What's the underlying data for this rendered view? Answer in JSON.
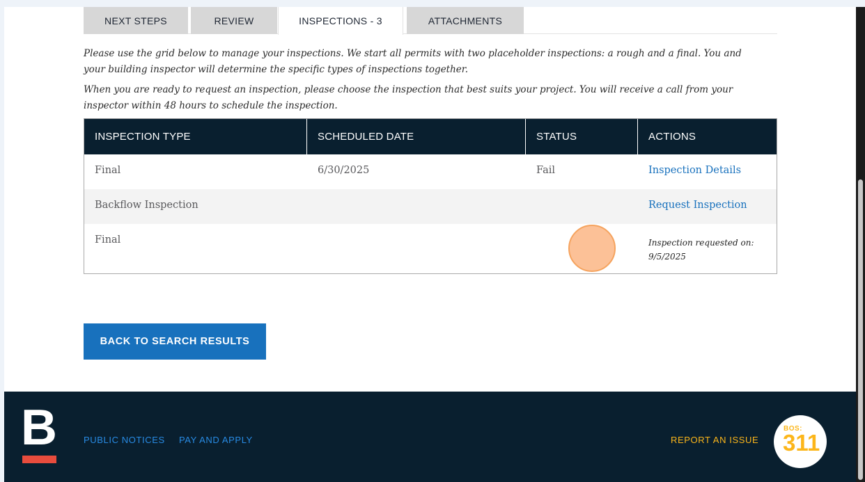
{
  "tabs": [
    {
      "label": "NEXT STEPS"
    },
    {
      "label": "REVIEW"
    },
    {
      "label": "INSPECTIONS - 3",
      "active": true
    },
    {
      "label": "ATTACHMENTS"
    }
  ],
  "intro": {
    "p1": "Please use the grid below to manage your inspections. We start all permits with two placeholder inspections: a rough and a final. You and your building inspector will determine the specific types of inspections together.",
    "p2": "When you are ready to request an inspection, please choose the inspection that best suits your project. You will receive a call from your inspector within 48 hours to schedule the inspection."
  },
  "table": {
    "headers": [
      "INSPECTION TYPE",
      "SCHEDULED DATE",
      "STATUS",
      "ACTIONS"
    ],
    "rows": [
      {
        "type": "Final",
        "date": "6/30/2025",
        "status": "Fail",
        "action": "Inspection Details"
      },
      {
        "type": "Backflow Inspection",
        "date": "",
        "status": "",
        "action": "Request Inspection"
      },
      {
        "type": "Final",
        "date": "",
        "status": "",
        "note_label": "Inspection requested on:",
        "note_date": "9/5/2025"
      }
    ]
  },
  "back_button": "BACK TO SEARCH RESULTS",
  "footer": {
    "logo_letter": "B",
    "links": [
      "PUBLIC NOTICES",
      "PAY AND APPLY"
    ],
    "report": "REPORT AN ISSUE",
    "bos_small": "BOS:",
    "bos_big": "311"
  },
  "colors": {
    "navy": "#091f2f",
    "link_blue": "#1871bd",
    "footer_link": "#288be4",
    "yellow": "#fcb61a",
    "red": "#e84c3d"
  }
}
